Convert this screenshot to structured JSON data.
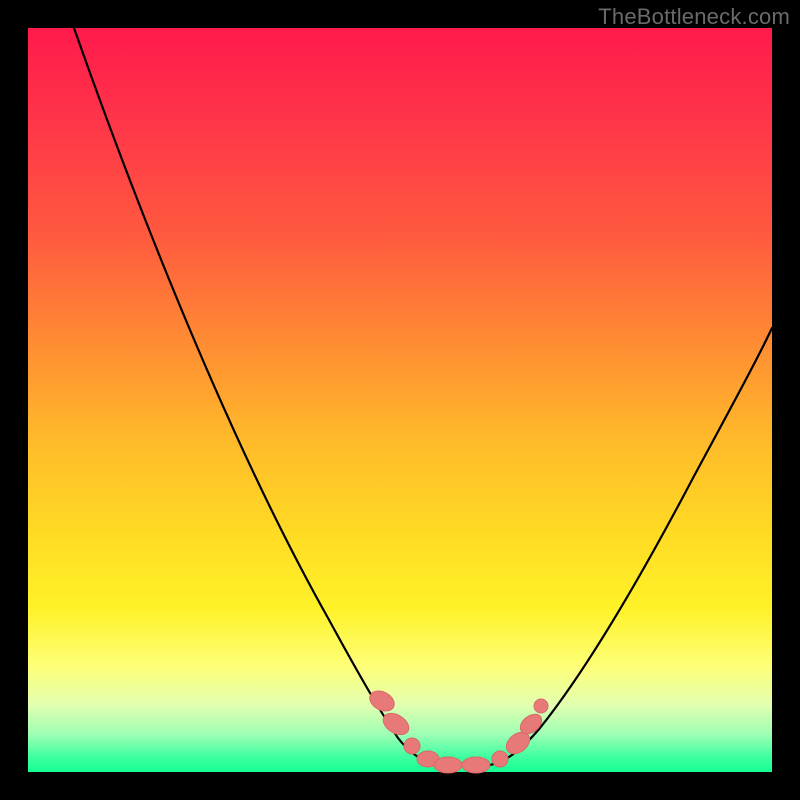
{
  "watermark": "TheBottleneck.com",
  "colors": {
    "background": "#000000",
    "gradient_top": "#ff1a4b",
    "gradient_bottom": "#15ff94",
    "marker": "#e77a78",
    "curve": "#000000",
    "watermark_text": "#6a6a6a"
  },
  "chart_data": {
    "type": "line",
    "title": "",
    "xlabel": "",
    "ylabel": "",
    "xlim": [
      0,
      100
    ],
    "ylim": [
      0,
      100
    ],
    "grid": false,
    "legend": false,
    "x": [
      0,
      5,
      10,
      15,
      20,
      25,
      30,
      35,
      40,
      45,
      47.5,
      50,
      52.5,
      55,
      57.5,
      60,
      62.5,
      65,
      70,
      75,
      80,
      85,
      90,
      95,
      100
    ],
    "y": [
      100,
      90,
      80,
      70,
      60,
      50,
      40,
      30,
      20,
      12,
      8,
      5,
      3,
      1.5,
      1,
      1,
      1.5,
      3,
      8,
      15,
      24,
      33,
      42,
      50,
      58
    ],
    "marker_points_x": [
      45,
      47.5,
      50,
      52.5,
      55,
      57.5,
      60,
      62.5,
      65
    ],
    "marker_points_y": [
      12,
      8,
      5,
      3,
      1.5,
      1,
      1,
      1.5,
      3
    ],
    "note": "V-shaped bottleneck curve; left branch descends from top-left, flat minimum near x≈55–60 at y≈1, right branch rises with lower slope. Salmon markers cluster around the trough."
  }
}
